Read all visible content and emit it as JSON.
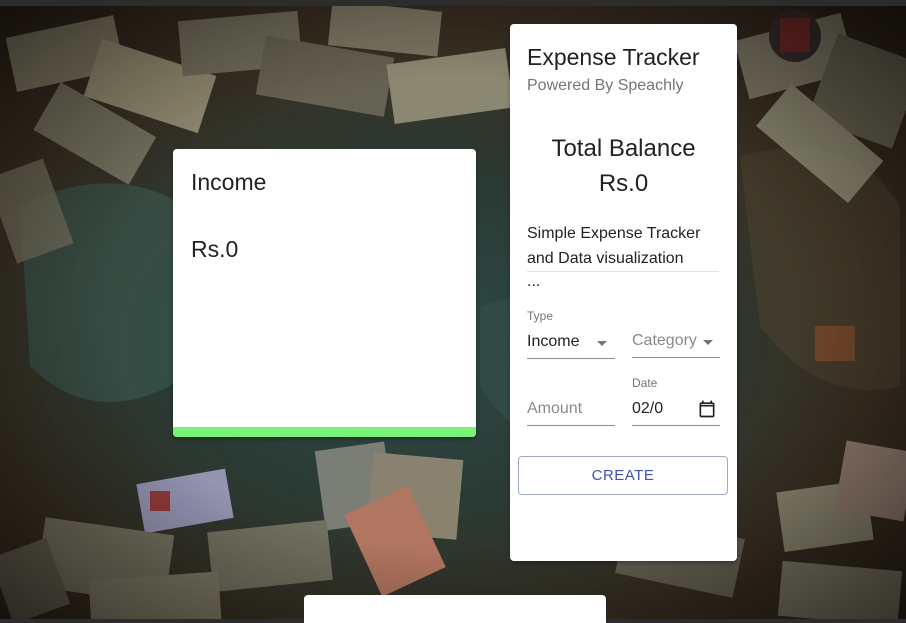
{
  "income_card": {
    "title": "Income",
    "amount": "Rs.0",
    "accent_color": "#79f279"
  },
  "tracker": {
    "title": "Expense Tracker",
    "subtitle": "Powered By Speachly",
    "balance_label": "Total Balance",
    "balance_value": "Rs.0",
    "description_line1": "Simple Expense Tracker",
    "description_line2": "and Data visualization",
    "ellipsis": "...",
    "form": {
      "type_label": "Type",
      "type_value": "Income",
      "category_placeholder": "Category",
      "amount_placeholder": "Amount",
      "date_label": "Date",
      "date_value": "02/0",
      "create_label": "CREATE"
    },
    "button_color": "#3f51b5"
  },
  "icons": [
    "chevron-down-icon",
    "calendar-icon"
  ]
}
